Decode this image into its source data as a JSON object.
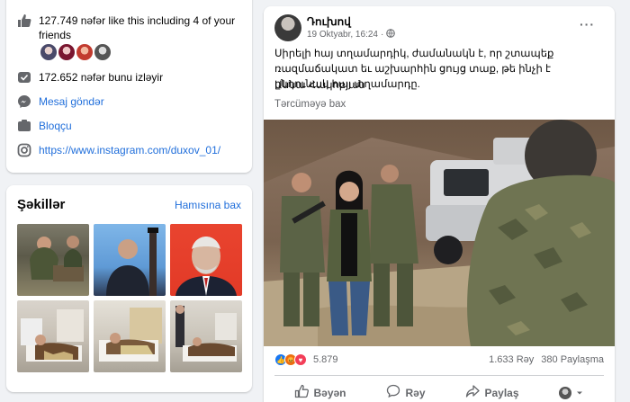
{
  "intro": {
    "likes_text": "127.749 nəfər like this including 4 of your friends",
    "followers_text": "172.652 nəfər bunu izləyir",
    "message_label": "Mesaj göndər",
    "category_label": "Bloqçu",
    "instagram_url": "https://www.instagram.com/duxov_01/"
  },
  "photos": {
    "title": "Şəkillər",
    "see_all_label": "Hamısına bax"
  },
  "post": {
    "author": "Դուխով",
    "date": "19 Oktyabr, 16:24",
    "more_icon": "more-dots-icon",
    "text": "Սիրելի հայ տղամարդիկ, ժամանակն է, որ շտապեք ռազմաճակատ եւ աշխարհին ցույց տաք, թե ինչի է ընդունակ հայ տղամարդը.",
    "signature": "Աննա Հակոբյան",
    "translate_label": "Tərcüməyə bax",
    "reactions_count": "5.879",
    "comments_count": "1.633 Rəy",
    "shares_count": "380 Paylaşma",
    "like_label": "Bəyən",
    "comment_label": "Rəy",
    "share_label": "Paylaş"
  },
  "colors": {
    "link": "#216fdb",
    "muted": "#65676b",
    "like_blue": "#1877f2",
    "love_red": "#f33e58",
    "angry_orange": "#e9710f"
  }
}
